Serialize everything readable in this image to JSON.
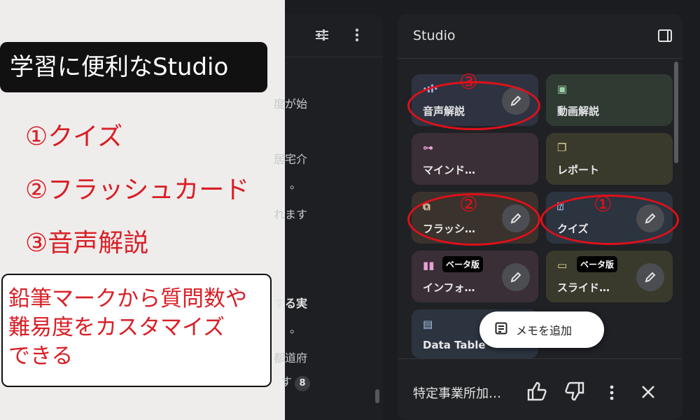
{
  "annotation": {
    "title": "学習に便利なStudio",
    "features": [
      "①クイズ",
      "②フラッシュカード",
      "③音声解説"
    ],
    "note_lines": [
      "鉛筆マークから質問数や",
      "難易度をカスタマイズ",
      "できる"
    ]
  },
  "chat": {
    "fragments": [
      "度が始",
      "居宅介",
      "。",
      "れます",
      "する実",
      "。",
      "都道府",
      "す"
    ],
    "citation": "8"
  },
  "studio": {
    "title": "Studio",
    "cards": [
      {
        "label": "音声解説",
        "icon": "audio-waveform-icon",
        "bg": "#2f3341",
        "fg": "#a8b7e8",
        "editable": true
      },
      {
        "label": "動画解説",
        "icon": "video-play-icon",
        "bg": "#2f3a33",
        "fg": "#9fd1a8",
        "editable": false
      },
      {
        "label": "マインド…",
        "icon": "mindmap-icon",
        "bg": "#3a2f36",
        "fg": "#e6a2d3",
        "editable": false
      },
      {
        "label": "レポート",
        "icon": "report-icon",
        "bg": "#3a3a2c",
        "fg": "#e6dc9a",
        "editable": false
      },
      {
        "label": "フラッシ…",
        "icon": "flashcard-icon",
        "bg": "#3a322c",
        "fg": "#e6c6a2",
        "editable": true
      },
      {
        "label": "クイズ",
        "icon": "quiz-icon",
        "bg": "#2c3440",
        "fg": "#a8c6e6",
        "editable": true
      },
      {
        "label": "インフォ…",
        "icon": "infographic-icon",
        "bg": "#3a2f36",
        "fg": "#e6a2d3",
        "editable": true,
        "badge": "ベータ版"
      },
      {
        "label": "スライド…",
        "icon": "slides-icon",
        "bg": "#3a3a2c",
        "fg": "#e6dc9a",
        "editable": true,
        "badge": "ベータ版"
      },
      {
        "label": "Data Table",
        "icon": "table-icon",
        "bg": "#2c3440",
        "fg": "#a8c6e6",
        "editable": false
      }
    ],
    "circle_numbers": [
      "③",
      "②",
      "①"
    ],
    "add_note_label": "メモを追加",
    "bottom_title": "特定事業所加…"
  }
}
